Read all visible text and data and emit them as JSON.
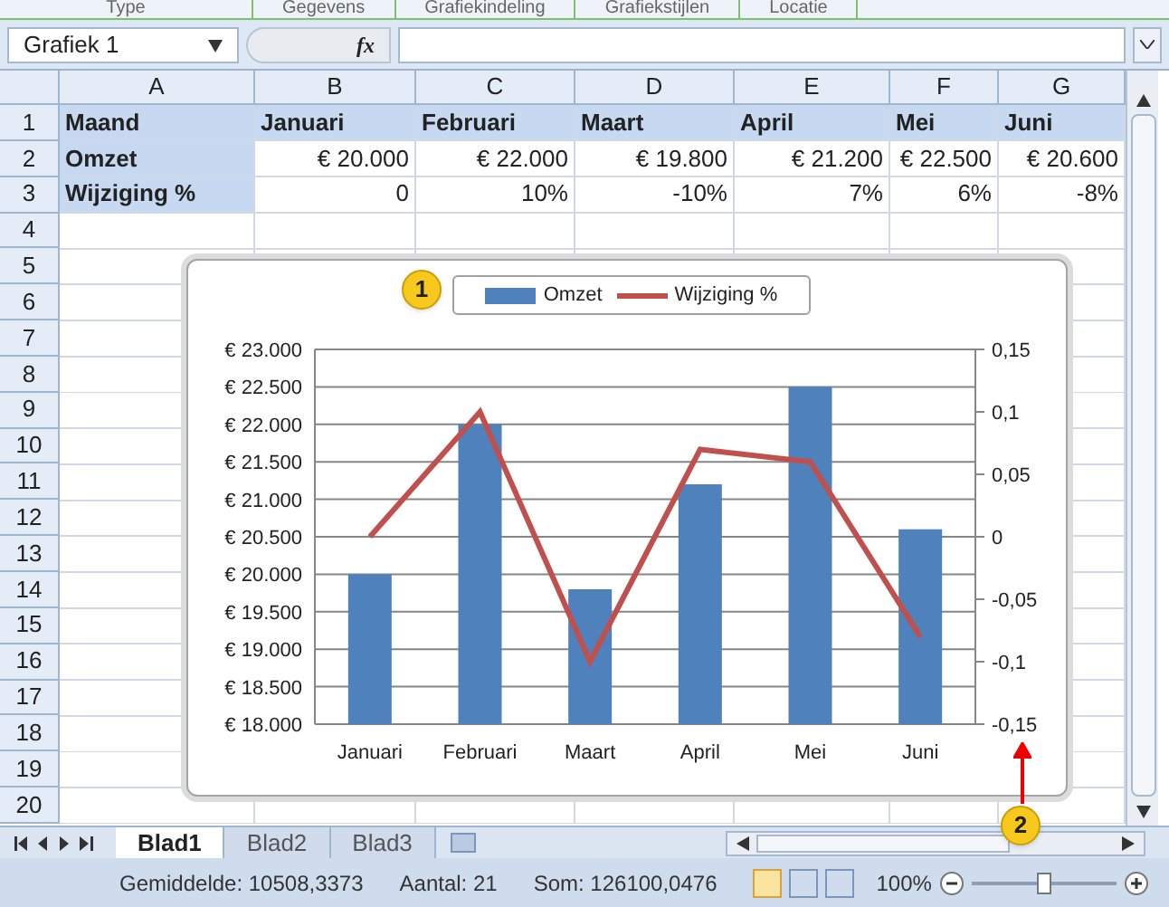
{
  "ribbon_groups": [
    "Type",
    "Gegevens",
    "Grafiekindeling",
    "Grafiekstijlen",
    "Locatie"
  ],
  "formula_bar": {
    "name_box": "Grafiek 1",
    "fx": "fx"
  },
  "columns": [
    "A",
    "B",
    "C",
    "D",
    "E",
    "F",
    "G"
  ],
  "rows": [
    {
      "number": "1",
      "cells": [
        "Maand",
        "Januari",
        "Februari",
        "Maart",
        "April",
        "Mei",
        "Juni"
      ]
    },
    {
      "number": "2",
      "cells": [
        "Omzet",
        "€ 20.000",
        "€ 22.000",
        "€ 19.800",
        "€ 21.200",
        "€ 22.500",
        "€ 20.600"
      ]
    },
    {
      "number": "3",
      "cells": [
        "Wijziging %",
        "0",
        "10%",
        "-10%",
        "7%",
        "6%",
        "-8%"
      ]
    },
    {
      "number": "4",
      "cells": []
    },
    {
      "number": "5",
      "cells": []
    },
    {
      "number": "6",
      "cells": []
    },
    {
      "number": "7",
      "cells": []
    },
    {
      "number": "8",
      "cells": []
    },
    {
      "number": "9",
      "cells": []
    },
    {
      "number": "10",
      "cells": []
    },
    {
      "number": "11",
      "cells": []
    },
    {
      "number": "12",
      "cells": []
    },
    {
      "number": "13",
      "cells": []
    },
    {
      "number": "14",
      "cells": []
    },
    {
      "number": "15",
      "cells": []
    },
    {
      "number": "16",
      "cells": []
    },
    {
      "number": "17",
      "cells": []
    },
    {
      "number": "18",
      "cells": []
    },
    {
      "number": "19",
      "cells": []
    },
    {
      "number": "20",
      "cells": []
    }
  ],
  "chart": {
    "chart_data": {
      "type": "bar",
      "categories": [
        "Januari",
        "Februari",
        "Maart",
        "April",
        "Mei",
        "Juni"
      ],
      "series": [
        {
          "name": "Omzet",
          "color": "#4f81bd",
          "values": [
            20000,
            22000,
            19800,
            21200,
            22500,
            20600
          ]
        }
      ],
      "ylim": [
        18000,
        23000
      ],
      "grid": true,
      "yticks": [
        {
          "value": 23000,
          "label": "€ 23.000"
        },
        {
          "value": 22500,
          "label": "€ 22.500"
        },
        {
          "value": 22000,
          "label": "€ 22.000"
        },
        {
          "value": 21500,
          "label": "€ 21.500"
        },
        {
          "value": 21000,
          "label": "€ 21.000"
        },
        {
          "value": 20500,
          "label": "€ 20.500"
        },
        {
          "value": 20000,
          "label": "€ 20.000"
        },
        {
          "value": 19500,
          "label": "€ 19.500"
        },
        {
          "value": 19000,
          "label": "€ 19.000"
        },
        {
          "value": 18500,
          "label": "€ 18.500"
        },
        {
          "value": 18000,
          "label": "€ 18.000"
        }
      ]
    },
    "overlay": {
      "chart_data": {
        "type": "line",
        "series": [
          {
            "name": "Wijziging %",
            "color": "#c0504d",
            "values": [
              0,
              0.1,
              -0.1,
              0.07,
              0.06,
              -0.08
            ]
          }
        ],
        "ylim": [
          -0.15,
          0.15
        ],
        "yticks": [
          {
            "value": 0.15,
            "label": "0,15"
          },
          {
            "value": 0.1,
            "label": "0,1"
          },
          {
            "value": 0.05,
            "label": "0,05"
          },
          {
            "value": 0,
            "label": "0"
          },
          {
            "value": -0.05,
            "label": "-0,05"
          },
          {
            "value": -0.1,
            "label": "-0,1"
          },
          {
            "value": -0.15,
            "label": "-0,15"
          }
        ]
      }
    }
  },
  "callouts": [
    "1",
    "2"
  ],
  "sheet_tabs": [
    {
      "label": "Blad1",
      "selected": true
    },
    {
      "label": "Blad2",
      "selected": false
    },
    {
      "label": "Blad3",
      "selected": false
    }
  ],
  "status_bar": {
    "items": [
      "Gemiddelde: 10508,3373",
      "Aantal: 21",
      "Som: 126100,0476"
    ],
    "zoom": "100%",
    "level": 0.5
  }
}
